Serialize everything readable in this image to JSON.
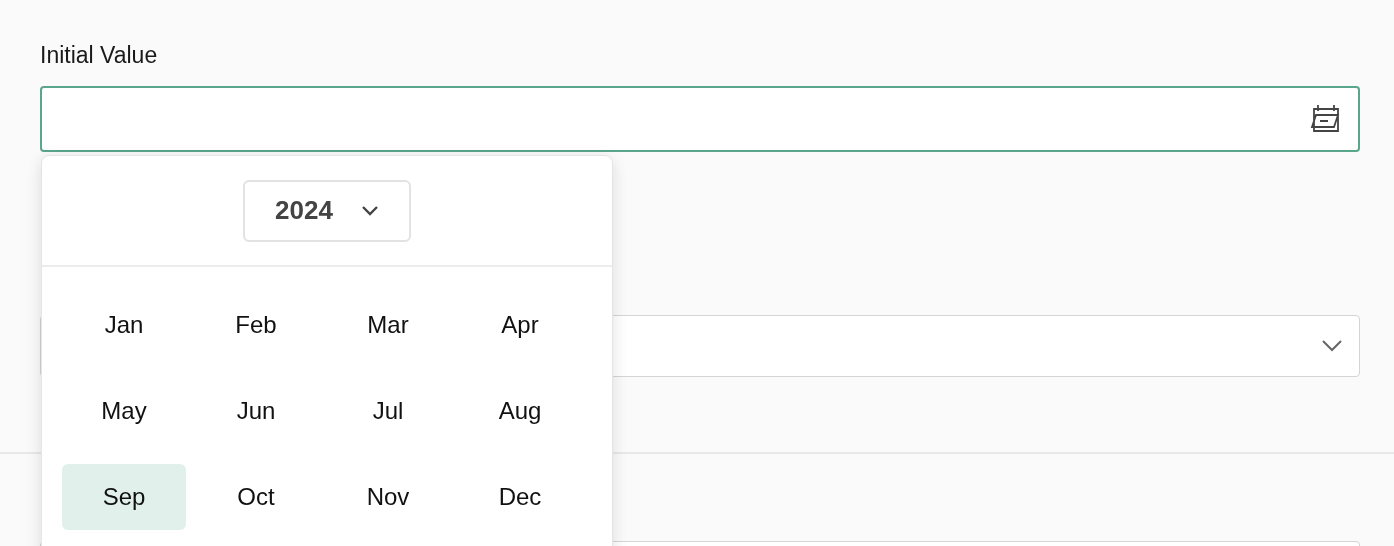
{
  "field": {
    "label": "Initial Value",
    "focused": true
  },
  "picker": {
    "year": "2024",
    "months": [
      {
        "label": "Jan",
        "selected": false
      },
      {
        "label": "Feb",
        "selected": false
      },
      {
        "label": "Mar",
        "selected": false
      },
      {
        "label": "Apr",
        "selected": false
      },
      {
        "label": "May",
        "selected": false
      },
      {
        "label": "Jun",
        "selected": false
      },
      {
        "label": "Jul",
        "selected": false
      },
      {
        "label": "Aug",
        "selected": false
      },
      {
        "label": "Sep",
        "selected": true
      },
      {
        "label": "Oct",
        "selected": false
      },
      {
        "label": "Nov",
        "selected": false
      },
      {
        "label": "Dec",
        "selected": false
      }
    ]
  }
}
